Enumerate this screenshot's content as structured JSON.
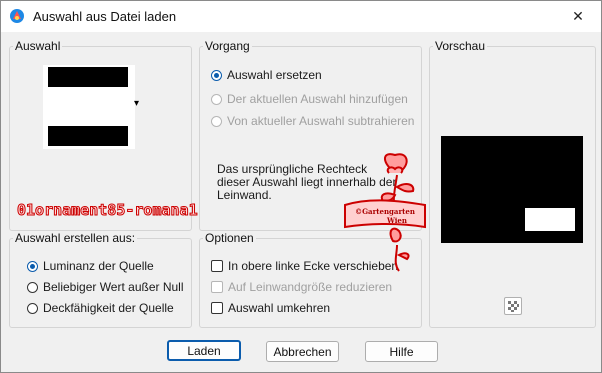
{
  "window": {
    "title": "Auswahl aus Datei laden",
    "close_glyph": "✕"
  },
  "auswahl": {
    "legend": "Auswahl",
    "dropdown_glyph": "▾"
  },
  "vorgang": {
    "legend": "Vorgang",
    "options": [
      {
        "label": "Auswahl ersetzen",
        "checked": true,
        "enabled": true
      },
      {
        "label": "Der aktuellen Auswahl hinzufügen",
        "checked": false,
        "enabled": false
      },
      {
        "label": "Von aktueller Auswahl subtrahieren",
        "checked": false,
        "enabled": false
      }
    ],
    "info": "Das ursprüngliche Rechteck dieser Auswahl liegt innerhalb der Leinwand."
  },
  "vorschau": {
    "legend": "Vorschau"
  },
  "erstellen": {
    "legend": "Auswahl erstellen aus:",
    "options": [
      {
        "label": "Luminanz der Quelle",
        "checked": true
      },
      {
        "label": "Beliebiger Wert außer Null",
        "checked": false
      },
      {
        "label": "Deckfähigkeit der Quelle",
        "checked": false
      }
    ]
  },
  "optionen": {
    "legend": "Optionen",
    "checks": [
      {
        "label": "In obere linke Ecke verschieben",
        "checked": false,
        "enabled": true
      },
      {
        "label": "Auf Leinwandgröße reduzieren",
        "checked": false,
        "enabled": false
      },
      {
        "label": "Auswahl umkehren",
        "checked": false,
        "enabled": true
      }
    ]
  },
  "buttons": {
    "laden": "Laden",
    "abbrechen": "Abbrechen",
    "hilfe": "Hilfe"
  },
  "watermark": {
    "left": "01ornament85-romana1",
    "seal_line1": "©Gartengarten",
    "seal_line2": "Wien"
  },
  "colors": {
    "accent": "#0b5cad",
    "seal_red": "#cc0000"
  },
  "icons": {
    "app": "paint-app-icon",
    "preview_toggle": "checkerboard-icon"
  }
}
